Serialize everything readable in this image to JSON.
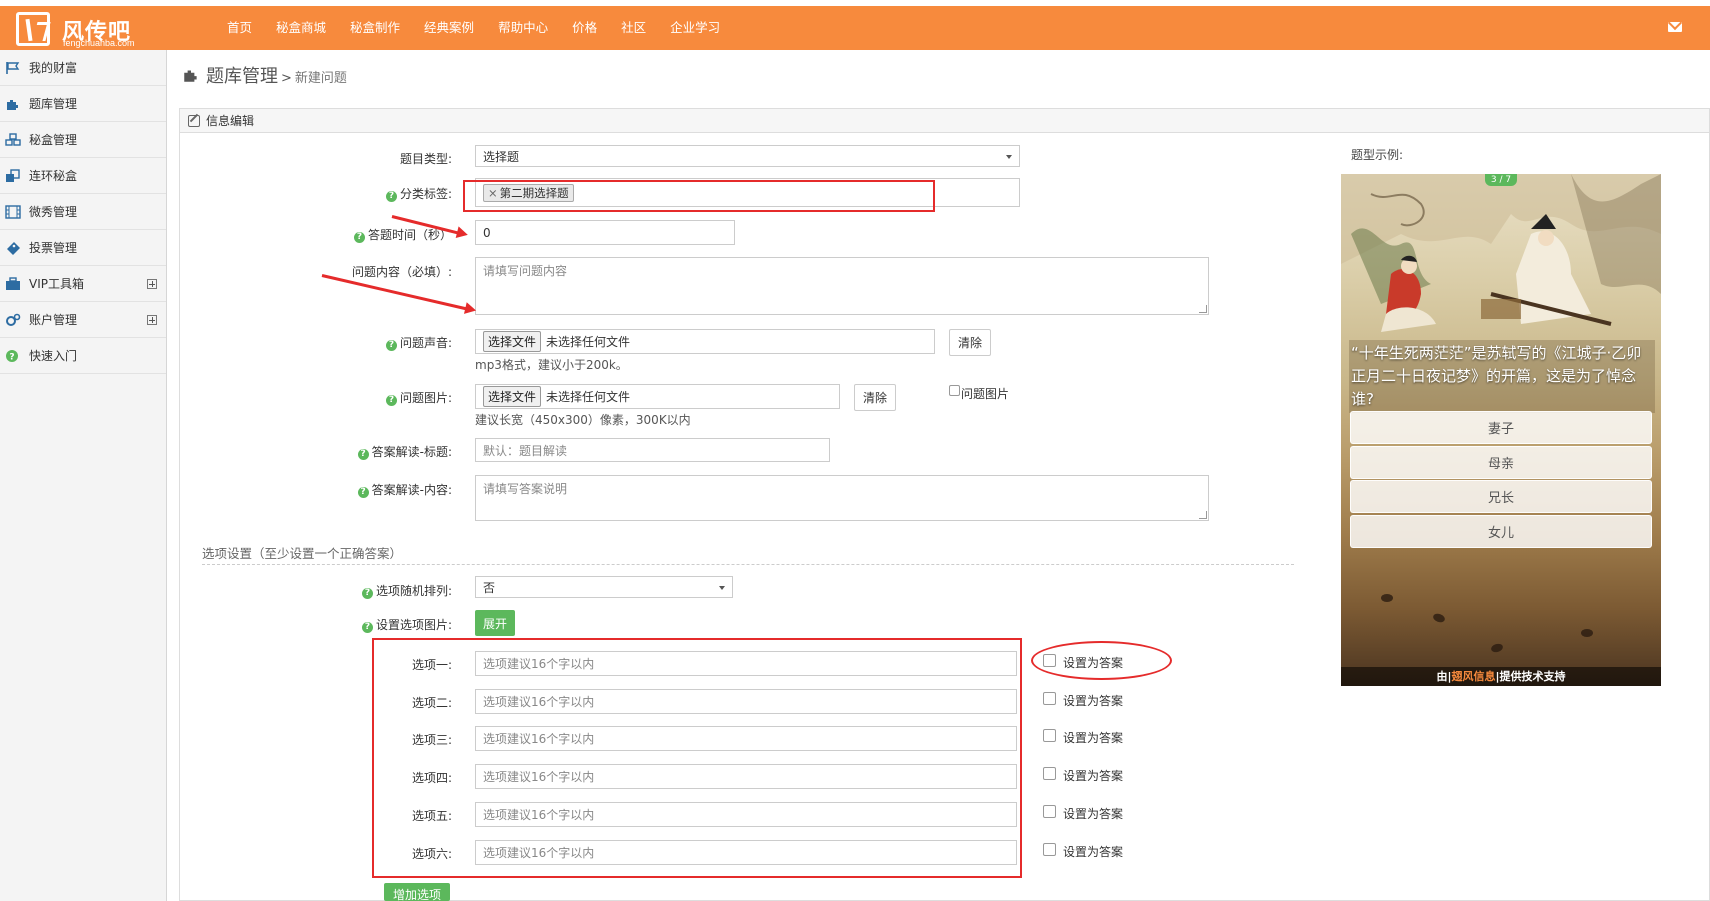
{
  "brand": {
    "name": "风传吧",
    "domain": "fengchuanba.com",
    "accent": "#f78a3d"
  },
  "nav": [
    {
      "label": "首页"
    },
    {
      "label": "秘盒商城"
    },
    {
      "label": "秘盒制作",
      "active": true
    },
    {
      "label": "经典案例"
    },
    {
      "label": "帮助中心"
    },
    {
      "label": "价格"
    },
    {
      "label": "社区"
    },
    {
      "label": "企业学习"
    }
  ],
  "sidebar": [
    {
      "label": "我的财富",
      "icon": "flag-icon"
    },
    {
      "label": "题库管理",
      "icon": "puzzle-icon"
    },
    {
      "label": "秘盒管理",
      "icon": "cubes-icon"
    },
    {
      "label": "连环秘盒",
      "icon": "clone-icon"
    },
    {
      "label": "微秀管理",
      "icon": "film-icon"
    },
    {
      "label": "投票管理",
      "icon": "ticket-icon"
    },
    {
      "label": "VIP工具箱",
      "icon": "briefcase-icon",
      "expandable": true
    },
    {
      "label": "账户管理",
      "icon": "cogs-icon",
      "expandable": true
    },
    {
      "label": "快速入门",
      "icon": "question-circle-icon"
    }
  ],
  "breadcrumb": {
    "main": "题库管理",
    "sep": ">",
    "sub": "新建问题"
  },
  "panel": {
    "title": "信息编辑"
  },
  "form": {
    "type": {
      "label": "题目类型:",
      "value": "选择题"
    },
    "tags": {
      "label": "分类标签:",
      "tag": "第二期选择题",
      "remove": "×"
    },
    "time": {
      "label": "答题时间（秒）",
      "value": "0"
    },
    "content": {
      "label": "问题内容（必填）:",
      "placeholder": "请填写问题内容"
    },
    "audio": {
      "label": "问题声音:",
      "button": "选择文件",
      "file": "未选择任何文件",
      "clear": "清除",
      "hint": "mp3格式，建议小于200k。"
    },
    "image": {
      "label": "问题图片:",
      "button": "选择文件",
      "file": "未选择任何文件",
      "clear": "清除",
      "checkbox": "问题图片",
      "hint": "建议长宽（450x300）像素，300K以内"
    },
    "answer_title": {
      "label": "答案解读-标题:",
      "placeholder": "默认：题目解读"
    },
    "answer_content": {
      "label": "答案解读-内容:",
      "placeholder": "请填写答案说明"
    }
  },
  "options_section": {
    "title": "选项设置（至少设置一个正确答案）",
    "random": {
      "label": "选项随机排列:",
      "value": "否"
    },
    "images": {
      "label": "设置选项图片:",
      "button": "展开"
    },
    "items": [
      {
        "label": "选项一:",
        "placeholder": "选项建议16个字以内",
        "answer": "设置为答案"
      },
      {
        "label": "选项二:",
        "placeholder": "选项建议16个字以内",
        "answer": "设置为答案"
      },
      {
        "label": "选项三:",
        "placeholder": "选项建议16个字以内",
        "answer": "设置为答案"
      },
      {
        "label": "选项四:",
        "placeholder": "选项建议16个字以内",
        "answer": "设置为答案"
      },
      {
        "label": "选项五:",
        "placeholder": "选项建议16个字以内",
        "answer": "设置为答案"
      },
      {
        "label": "选项六:",
        "placeholder": "选项建议16个字以内",
        "answer": "设置为答案"
      }
    ],
    "add_button": "增加选项"
  },
  "preview": {
    "title": "题型示例:",
    "badge": "3 / 7",
    "question": "“十年生死两茫茫”是苏轼写的《江城子·乙卯正月二十日夜记梦》的开篇，这是为了悼念谁?",
    "options": [
      "妻子",
      "母亲",
      "兄长",
      "女儿"
    ],
    "powered_prefix": "由|",
    "powered_brand": "翅风信息",
    "powered_suffix": "|提供技术支持"
  },
  "annotation_color": "#e52b2b"
}
